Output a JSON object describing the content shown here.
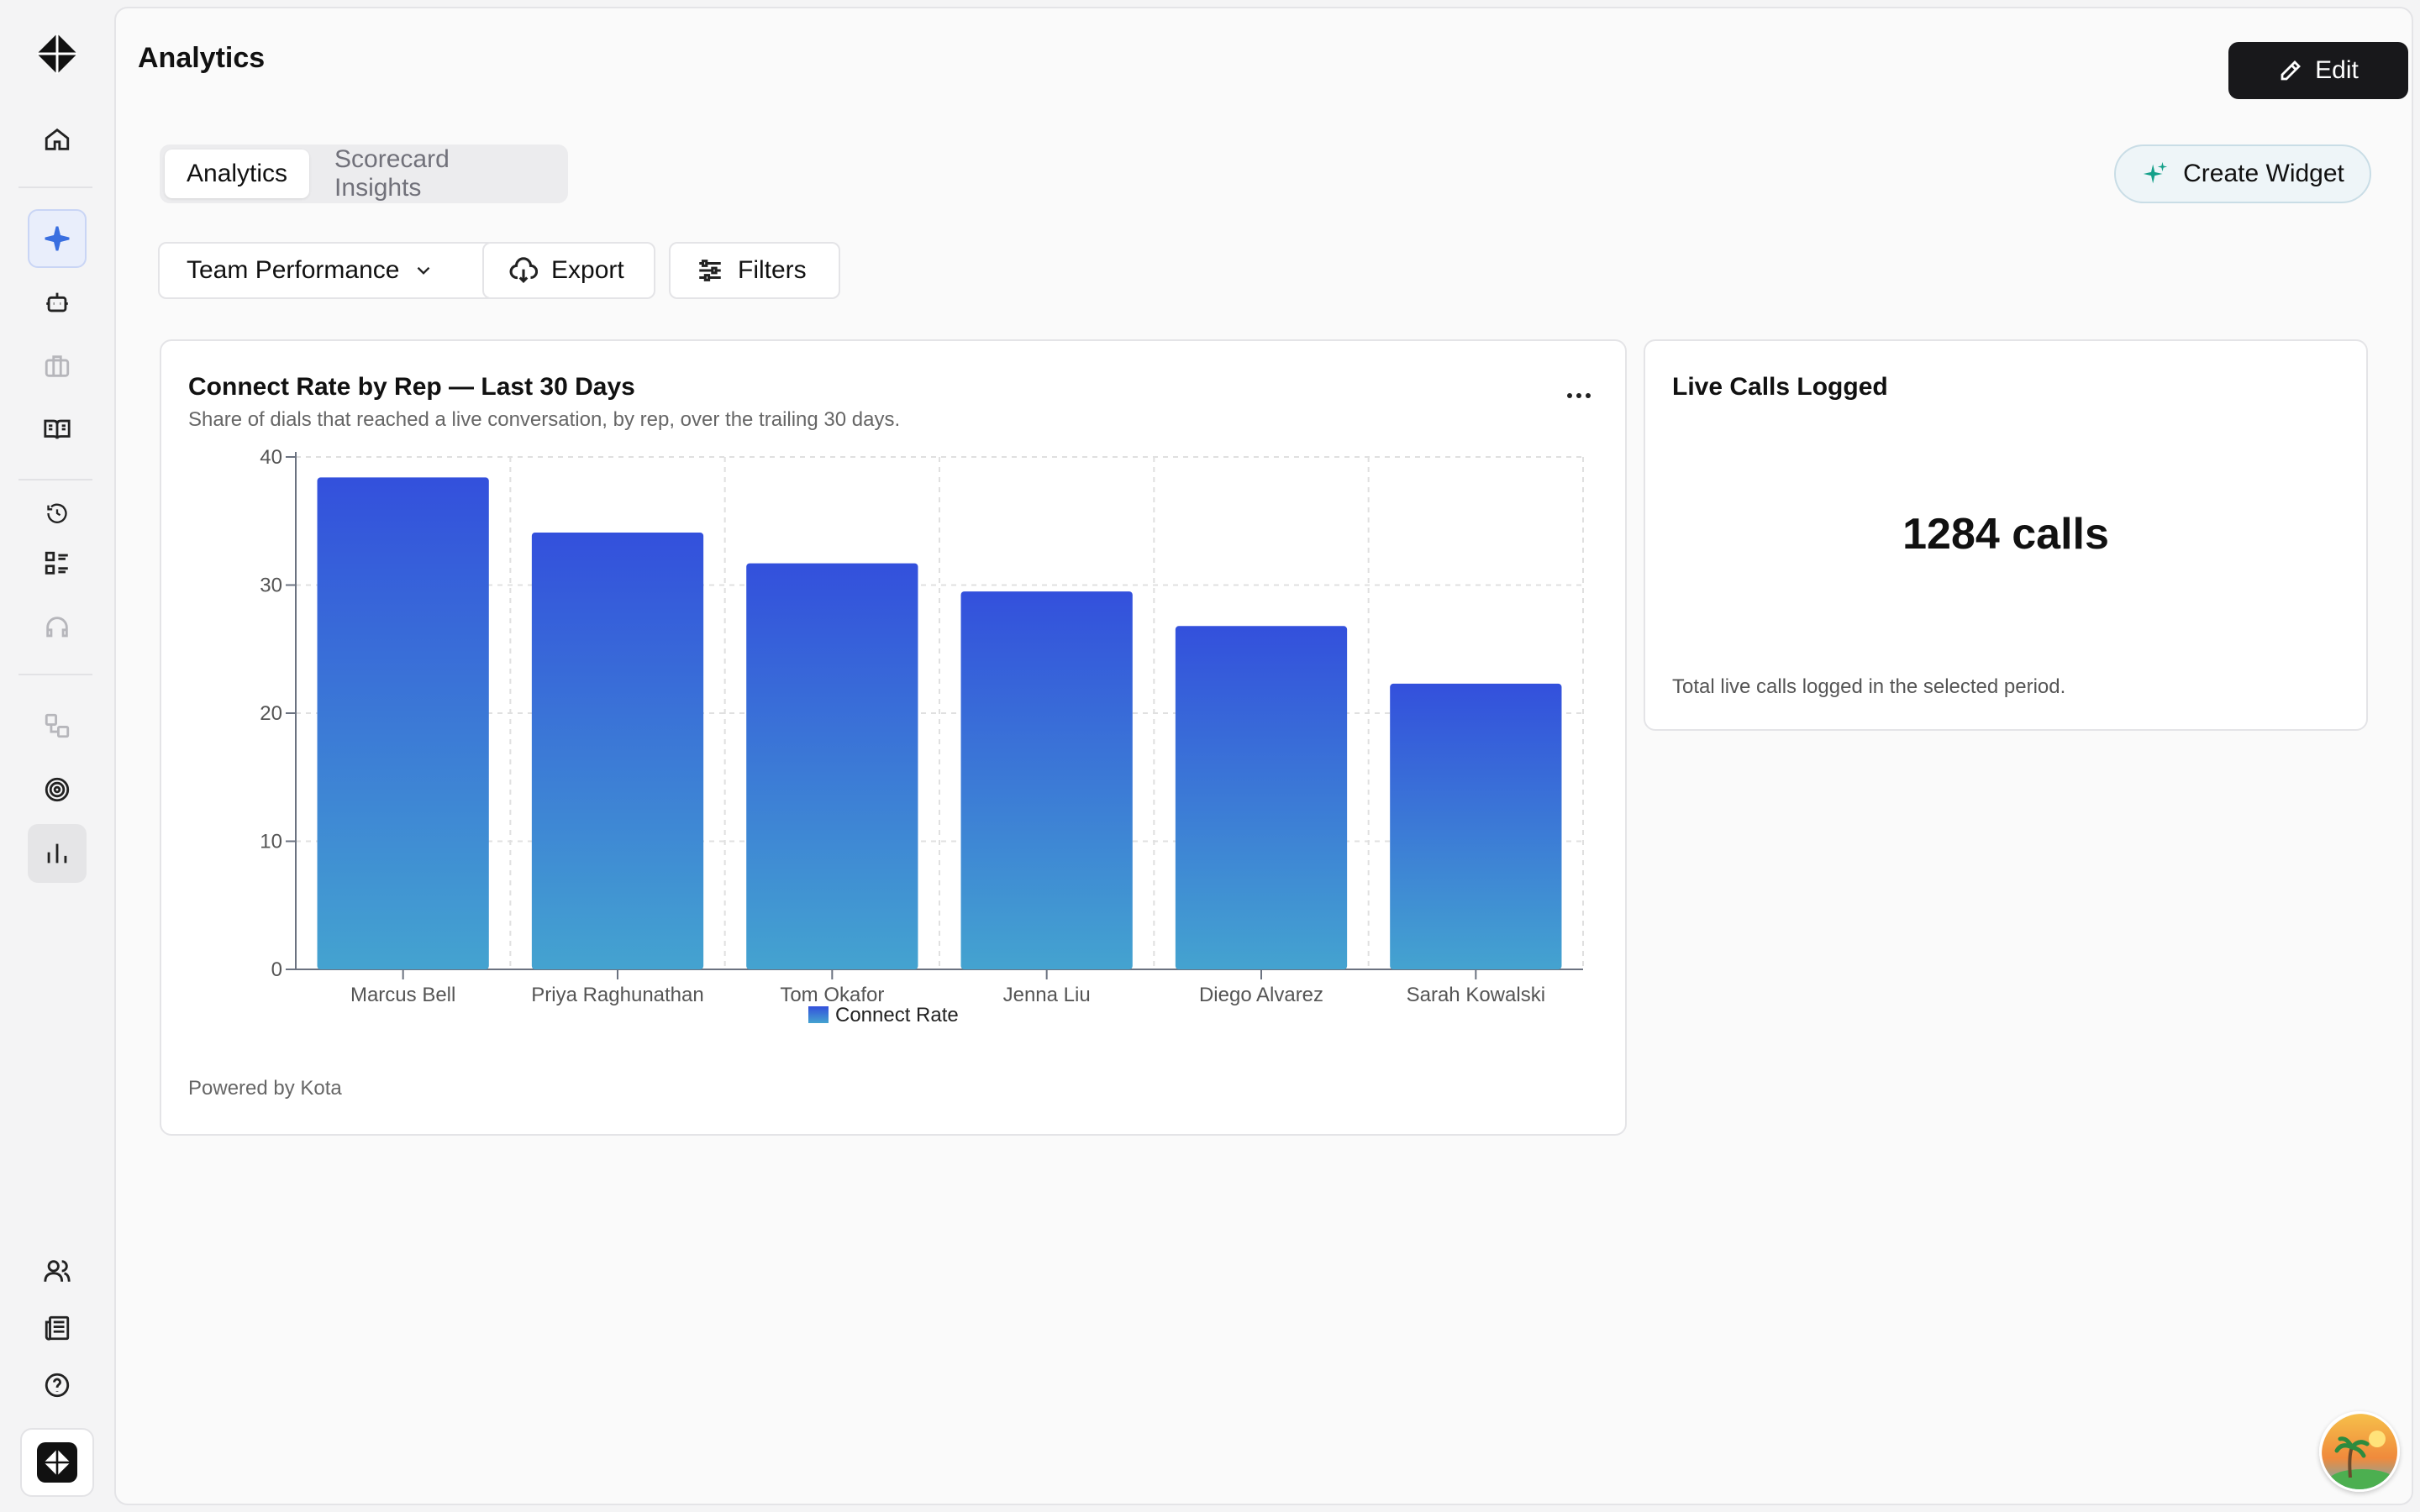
{
  "page": {
    "title": "Analytics",
    "edit_label": "Edit"
  },
  "tabs": [
    {
      "label": "Analytics",
      "active": true
    },
    {
      "label": "Scorecard Insights",
      "active": false
    }
  ],
  "create_widget_label": "Create Widget",
  "toolbar": {
    "report_select": "Team Performance",
    "export_label": "Export",
    "filters_label": "Filters"
  },
  "sidebar": {
    "icons": [
      "logo-icon",
      "home-icon",
      "sparkle-icon",
      "bot-icon",
      "briefcase-icon",
      "book-icon",
      "history-icon",
      "checklist-icon",
      "headset-icon",
      "workflow-icon",
      "target-icon",
      "bar-chart-icon",
      "users-icon",
      "newspaper-icon",
      "help-icon"
    ]
  },
  "chart_card": {
    "title": "Connect Rate by Rep — Last 30 Days",
    "subtitle": "Share of dials that reached a live conversation, by rep, over the trailing 30 days.",
    "footer": "Powered by Kota"
  },
  "chart_data": {
    "type": "bar",
    "categories": [
      "Marcus Bell",
      "Priya Raghunathan",
      "Tom Okafor",
      "Jenna Liu",
      "Diego Alvarez",
      "Sarah Kowalski"
    ],
    "series": [
      {
        "name": "Connect Rate",
        "values": [
          38.4,
          34.1,
          31.7,
          29.5,
          26.8,
          22.3
        ]
      }
    ],
    "ylim": [
      0,
      40
    ],
    "yticks": [
      0,
      10,
      20,
      30,
      40
    ],
    "grid": true,
    "legend": "bottom-center",
    "colors": {
      "top": "#3350dc",
      "bottom": "#44a3d0"
    }
  },
  "kpi_card": {
    "title": "Live Calls Logged",
    "value": "1284 calls",
    "description": "Total live calls logged in the selected period."
  }
}
